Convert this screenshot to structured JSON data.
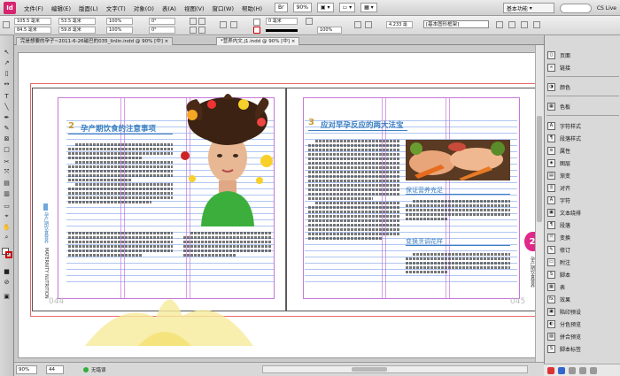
{
  "app": {
    "logo": "Id"
  },
  "menu": [
    "文件(F)",
    "编辑(E)",
    "版面(L)",
    "文字(T)",
    "对象(O)",
    "表(A)",
    "视图(V)",
    "窗口(W)",
    "帮助(H)"
  ],
  "menubar": {
    "zoom": "90%",
    "workspace": "基本功能",
    "cs_live": "CS Live"
  },
  "control": {
    "x": "105.5 毫米",
    "y": "84.5 毫米",
    "w": "53.5 毫米",
    "h": "59.8 毫米",
    "scale_x": "100%",
    "scale_y": "100%",
    "rotate": "0°",
    "shear": "0°",
    "stroke_weight": "0 毫米",
    "stroke_pct": "100%",
    "dim": "4.233 毫",
    "style": "[基本图形框架]",
    "percent": "100%"
  },
  "tabs": [
    {
      "label": "完是想要的孕子~2011-6-26磁巴的035_linlin.indd @ 90% [中]"
    },
    {
      "label": "*营养内文.j1.indd @ 90% [中]"
    }
  ],
  "left_page": {
    "num": "2",
    "title": "孕产期饮食的注意事项",
    "page_number": "044",
    "side_label": "孕产期饮食营养",
    "side_label2": "MATERNITY NUTRITION"
  },
  "right_page": {
    "num": "3",
    "title": "应对早孕反应的两大法宝",
    "sub1": "保证营养充足",
    "sub2": "变换烹调花样",
    "page_number": "045",
    "badge": "2",
    "side_label": "孕产期饮食营养"
  },
  "status": {
    "zoom": "90%",
    "page": "44",
    "errors": "无错误"
  },
  "panels": [
    {
      "icon": "page-icon",
      "label": "页面"
    },
    {
      "icon": "link-icon",
      "label": "链接"
    },
    {
      "icon": "color-icon",
      "label": "颜色"
    },
    {
      "icon": "swatch-icon",
      "label": "色板"
    },
    {
      "icon": "char-style-icon",
      "label": "字符样式"
    },
    {
      "icon": "para-style-icon",
      "label": "段落样式"
    },
    {
      "icon": "attr-icon",
      "label": "属性"
    },
    {
      "icon": "layer-icon",
      "label": "图层"
    },
    {
      "icon": "gradient-icon",
      "label": "渐变"
    },
    {
      "icon": "align-icon",
      "label": "对齐"
    },
    {
      "icon": "char-icon",
      "label": "字符"
    },
    {
      "icon": "wrap-icon",
      "label": "文本绕排"
    },
    {
      "icon": "para-icon",
      "label": "段落"
    },
    {
      "icon": "transform-icon",
      "label": "变换"
    },
    {
      "icon": "note-icon",
      "label": "修订"
    },
    {
      "icon": "preflight-icon",
      "label": "附注"
    },
    {
      "icon": "script-icon",
      "label": "脚本"
    },
    {
      "icon": "table-icon",
      "label": "表"
    },
    {
      "icon": "effects-icon",
      "label": "效果"
    },
    {
      "icon": "print-icon",
      "label": "陷印预设"
    },
    {
      "icon": "sep-icon",
      "label": "分色预览"
    },
    {
      "icon": "flatten-icon",
      "label": "拼合预览"
    },
    {
      "icon": "script-label-icon",
      "label": "脚本标签"
    }
  ],
  "colors": {
    "accent": "#3a7fc0",
    "badge": "#e0288a",
    "title_num": "#c89a2a"
  }
}
